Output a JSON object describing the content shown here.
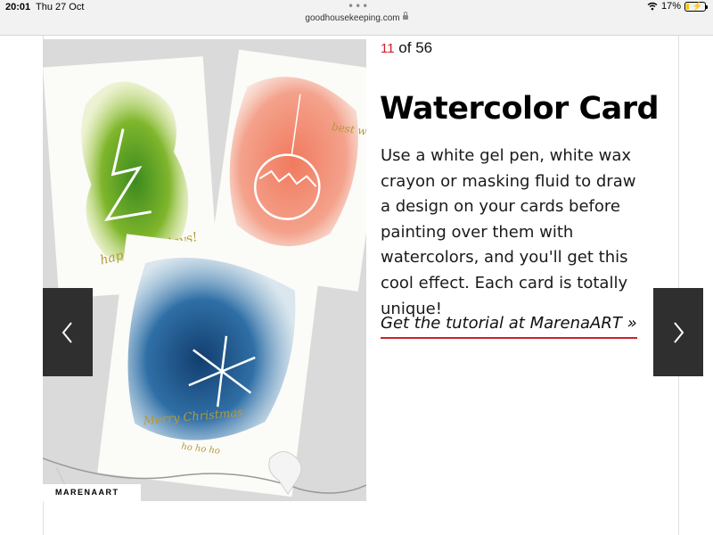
{
  "status_bar": {
    "time": "20:01",
    "date": "Thu 27 Oct",
    "url": "goodhousekeeping.com",
    "battery": "17%",
    "battery_level": 0.17
  },
  "slide": {
    "current": "11",
    "of_text": " of 56",
    "title": "Watercolor Card",
    "description": "Use a white gel pen, white wax crayon or masking fluid to draw a design on your cards before painting over them with watercolors, and you'll get this cool effect. Each card is totally unique!",
    "link_text": "Get the tutorial at MarenaART »",
    "photo_credit": "MARENAART"
  },
  "image": {
    "card_green_text": "happy holidays!",
    "card_red_text": "best wishes",
    "card_blue_text": "Merry Christmas",
    "card_blue_text2": "ho ho ho"
  },
  "colors": {
    "accent": "#d0202a",
    "nav_bg": "#2f2f2f"
  }
}
